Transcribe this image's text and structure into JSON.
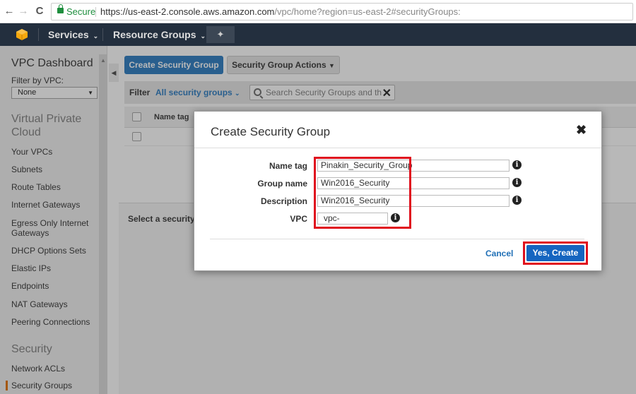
{
  "browser": {
    "back_glyph": "←",
    "forward_glyph": "→",
    "reload_glyph": "C",
    "secure_label": "Secure",
    "url_main": "https://us-east-2.console.aws.amazon.com",
    "url_path": "/vpc/home?region=us-east-2#securityGroups:"
  },
  "topnav": {
    "services": "Services",
    "resource_groups": "Resource Groups",
    "pin_glyph": "✦"
  },
  "sidebar": {
    "title": "VPC Dashboard",
    "filter_label": "Filter by VPC:",
    "filter_value": "None",
    "section_vpc": "Virtual Private Cloud",
    "items": [
      "Your VPCs",
      "Subnets",
      "Route Tables",
      "Internet Gateways",
      "Egress Only Internet Gateways",
      "DHCP Options Sets",
      "Elastic IPs",
      "Endpoints",
      "NAT Gateways",
      "Peering Connections"
    ],
    "section_security": "Security",
    "security_items": [
      "Network ACLs",
      "Security Groups"
    ]
  },
  "main": {
    "create_btn": "Create Security Group",
    "actions_btn": "Security Group Actions",
    "filter_label": "Filter",
    "filter_value": "All security groups",
    "search_placeholder": "Search Security Groups and their",
    "col_name_tag": "Name tag",
    "bottom_message": "Select a security"
  },
  "modal": {
    "title": "Create Security Group",
    "close_glyph": "✖",
    "fields": {
      "name_tag_label": "Name tag",
      "name_tag_value": "Pinakin_Security_Group",
      "group_name_label": "Group name",
      "group_name_value": "Win2016_Security",
      "description_label": "Description",
      "description_value": "Win2016_Security",
      "vpc_label": "VPC",
      "vpc_value": "vpc-"
    },
    "info_glyph": "i",
    "cancel": "Cancel",
    "confirm": "Yes, Create"
  },
  "colors": {
    "aws_nav": "#232f3e",
    "primary_button": "#3a84c5",
    "highlight": "#e0101e",
    "confirm_button": "#1565c0"
  }
}
